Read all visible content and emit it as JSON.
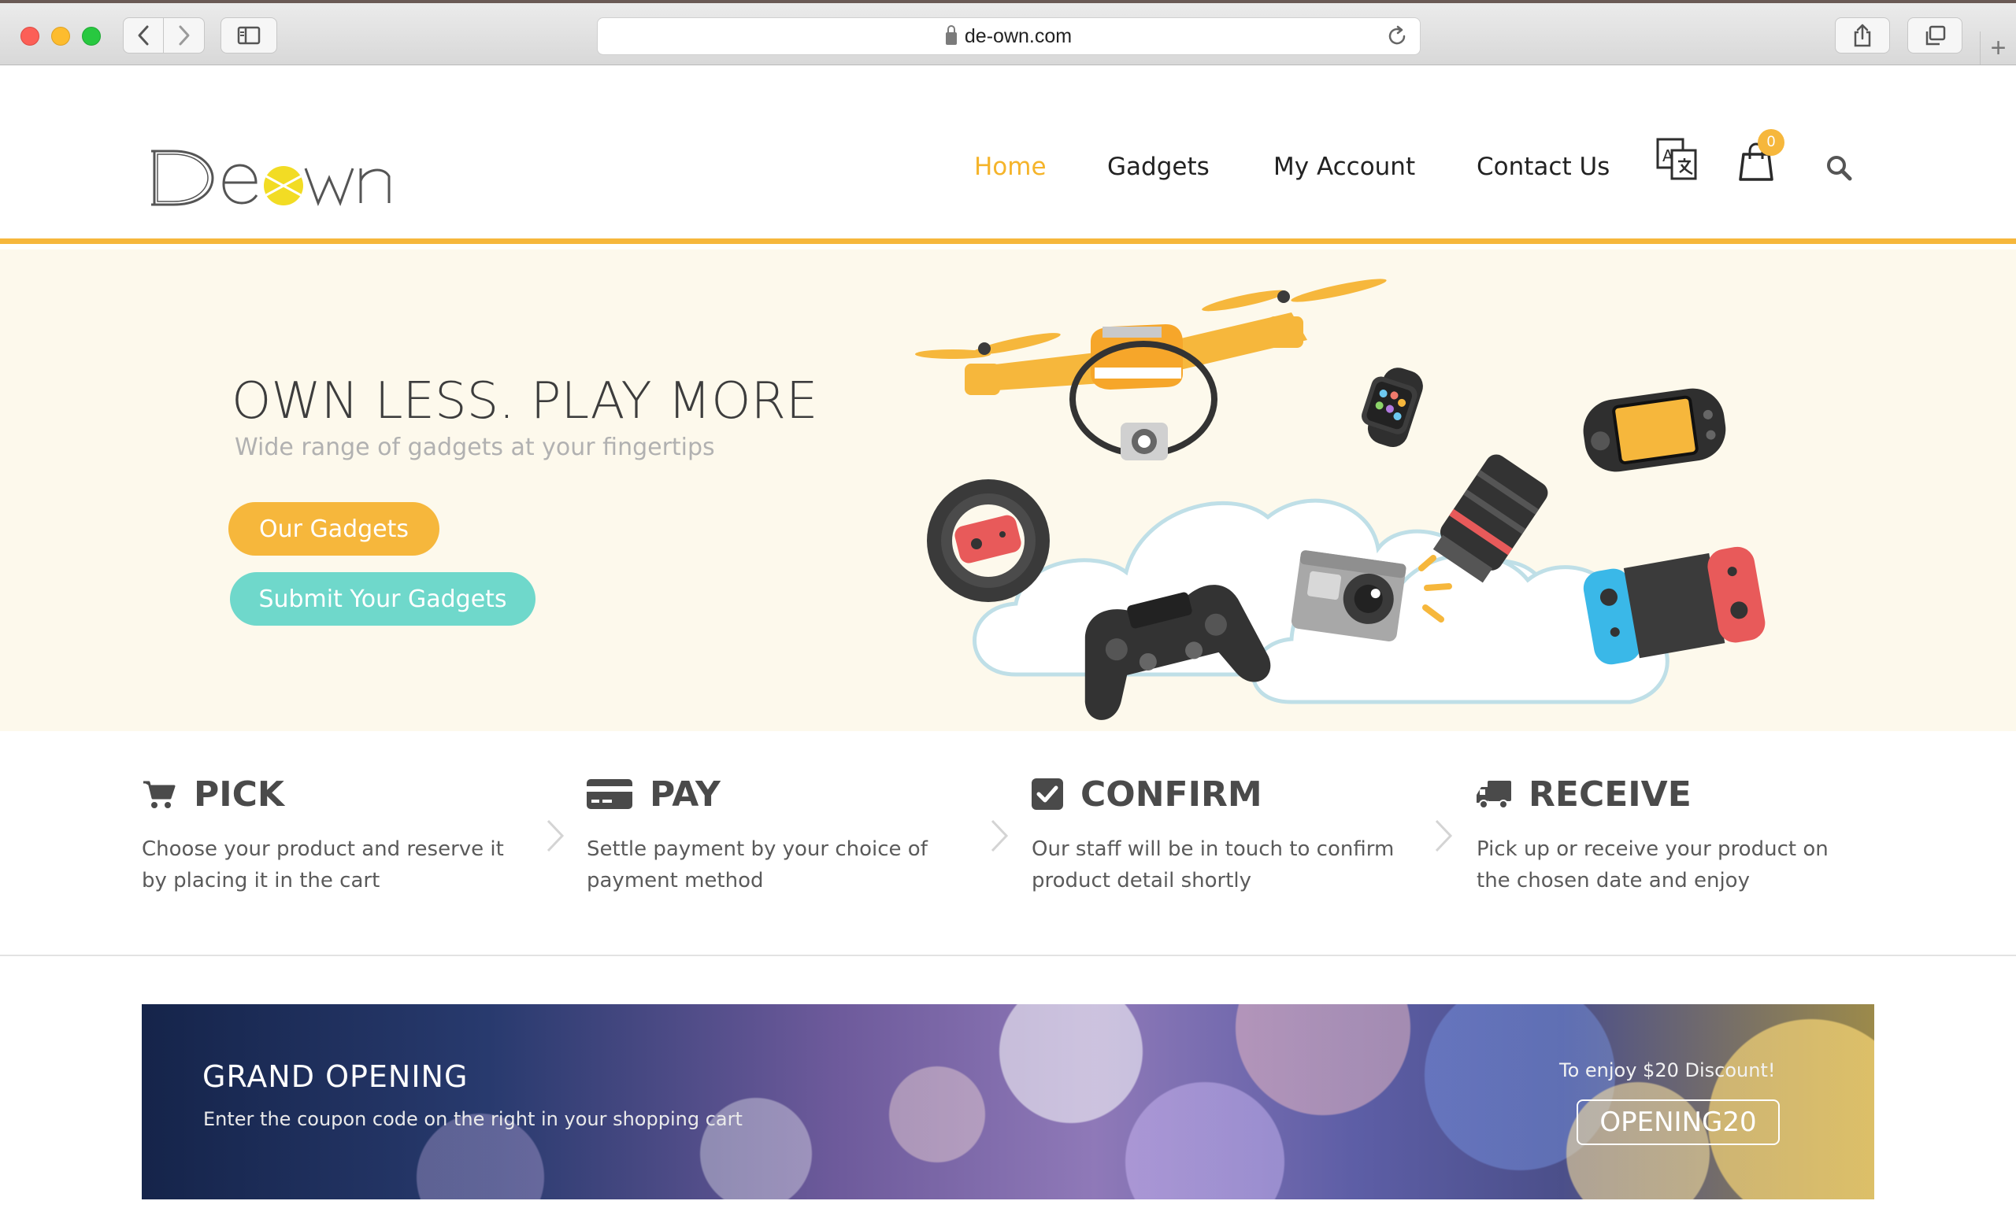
{
  "browser": {
    "url": "de-own.com",
    "icons": [
      "back-icon",
      "forward-icon",
      "sidebar-icon",
      "lock-icon",
      "reload-icon",
      "share-icon",
      "tabs-icon",
      "plus-icon"
    ]
  },
  "header": {
    "logo_text": "Deown",
    "nav": [
      {
        "label": "Home",
        "active": true
      },
      {
        "label": "Gadgets"
      },
      {
        "label": "My Account"
      },
      {
        "label": "Contact Us"
      }
    ],
    "cart_count": "0",
    "accent_color": "#f6b73c"
  },
  "hero": {
    "title": "OWN LESS. PLAY MORE",
    "subtitle": "Wide range of gadgets at your fingertips",
    "primary_button": "Our Gadgets",
    "secondary_button": "Submit Your Gadgets",
    "primary_color": "#f6b73c",
    "secondary_color": "#6fd8cb",
    "background": "#fdf9ec"
  },
  "steps": [
    {
      "title": "PICK",
      "text": "Choose your product and reserve it by placing it in the cart",
      "icon": "cart-icon"
    },
    {
      "title": "PAY",
      "text": "Settle payment by your choice of payment method",
      "icon": "credit-card-icon"
    },
    {
      "title": "CONFIRM",
      "text": "Our staff will be in touch to confirm product detail shortly",
      "icon": "checkbox-icon"
    },
    {
      "title": "RECEIVE",
      "text": "Pick up or receive your product on the chosen date and enjoy",
      "icon": "truck-icon"
    }
  ],
  "banner": {
    "title": "GRAND OPENING",
    "subtitle": "Enter the coupon code on the right in your shopping cart",
    "note": "To enjoy $20 Discount!",
    "code": "OPENING20"
  }
}
